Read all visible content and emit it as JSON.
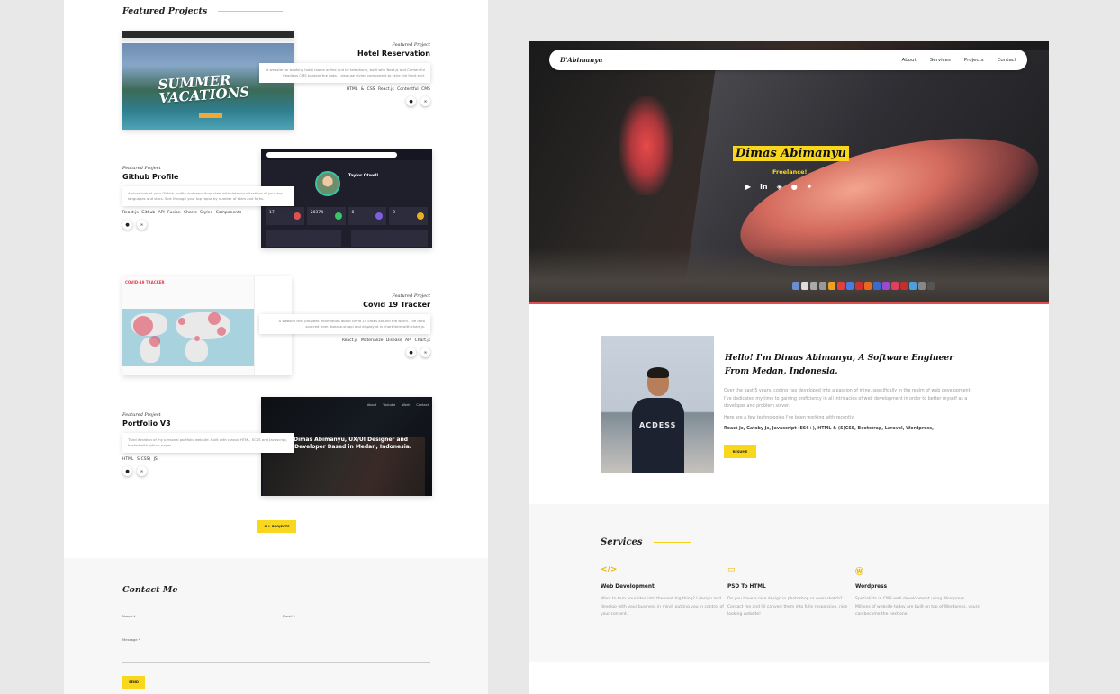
{
  "left": {
    "featured_heading": "Featured Projects",
    "projects": [
      {
        "kicker": "Featured Project",
        "title": "Hotel Reservation",
        "desc": "A website for booking hotel rooms online and by telephone, built with Next.js and Contentful headless CMS to store the data. I also use styled component to style the front end.",
        "tech": "HTML & CSS   React.js   Contentful CMS",
        "thumb_text": "SUMMER VACATIONS"
      },
      {
        "kicker": "Featured Project",
        "title": "Github Profile",
        "desc": "A nicer look at your GitHub profile and repository stats with data visualizations of your top languages and stars. Sort through your top repos by number of stars and forks.",
        "tech": "React.js   Github API   Fusion Charts   Styled Components",
        "thumb_name": "Taylor Otwell",
        "thumb_stats": [
          "17",
          "20374",
          "0",
          "9"
        ]
      },
      {
        "kicker": "Featured Project",
        "title": "Covid 19 Tracker",
        "desc": "A website that provides information about covid 19 cases around the world. The data sourced from disease.sh api and displayed in chart form with chart.js.",
        "tech": "React.js   Materialize   Disease API   Chart.js",
        "thumb_title": "COVID-19 TRACKER"
      },
      {
        "kicker": "Featured Project",
        "title": "Portfolio V3",
        "desc": "Third iteration of my personal portfolio website. Built with classic HTML, SCSS and Javascript, hosted with github pages.",
        "tech": "HTML   S(CSS)   JS",
        "thumb_hero": "Hello, I'm Dimas Abimanyu, UX/UI Designer and Front-end Developer Based in Medan, Indonesia.",
        "thumb_nav": "About Youtube Work Contact"
      }
    ],
    "all_projects_label": "ALL PROJECTS",
    "contact_heading": "Contact Me",
    "name_label": "Name *",
    "email_label": "Email *",
    "message_label": "Message *",
    "send_label": "SEND"
  },
  "right": {
    "brand": "D'Abimanyu",
    "nav": [
      "About",
      "Services",
      "Projects",
      "Contact"
    ],
    "hero_name": "Dimas Abimanyu",
    "hero_role": "Freelance!",
    "social_icons": [
      "youtube-icon",
      "linkedin-icon",
      "codepen-icon",
      "github-icon",
      "twitter-icon"
    ],
    "about_heading": "Hello! I'm Dimas Abimanyu, A Software Engineer From Medan, Indonesia.",
    "about_p1": "Over the past 5 years, coding has developed into a passion of mine, specifically in the realm of web development. I've dedicated my time to gaining proficiency in all intricacies of web development in order to better myself as a developer and problem solver.",
    "about_p2": "Here are a few technologies I've been working with recently:",
    "about_tech": "React Js,  Gatsby Js,  Javascript (ES6+),  HTML & (S)CSS,  Bootstrap,  Laravel,  Wordpress,",
    "resume_label": "RESUME",
    "photo_print": "ACDESS",
    "services_heading": "Services",
    "services": [
      {
        "icon": "code-icon",
        "glyph": "</>",
        "title": "Web Development",
        "desc": "Want to turn your idea into the next big thing? I design and develop with your business in mind, putting you in control of your content."
      },
      {
        "icon": "monitor-icon",
        "glyph": "▭",
        "title": "PSD To HTML",
        "desc": "Do you have a nice design in photoshop or even sketch? Contact me and I'll convert them into fully responsive, nice looking website!"
      },
      {
        "icon": "wordpress-icon",
        "glyph": "Ⓦ",
        "title": "Wordpress",
        "desc": "Specialists in CMS web development using Wordpress. Millions of website today are built on top of Wordpress, yours can become the next one!"
      }
    ]
  },
  "colors": {
    "accent": "#f9d71c",
    "text_muted": "#999999",
    "section_bg": "#f7f7f7"
  }
}
